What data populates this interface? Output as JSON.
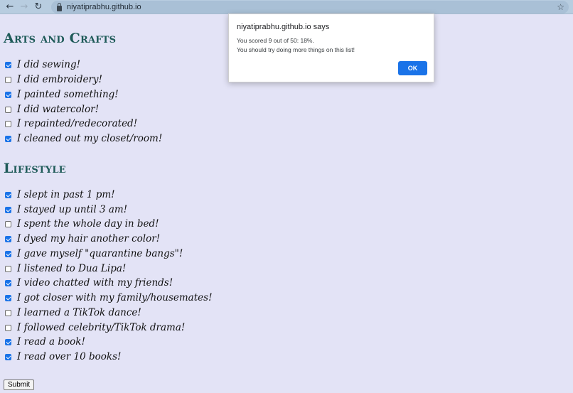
{
  "browser": {
    "back_icon": "←",
    "forward_icon": "→",
    "reload_icon": "↻",
    "url": "niyatiprabhu.github.io",
    "star_icon": "☆"
  },
  "sections": [
    {
      "title": "Arts and Crafts",
      "items": [
        {
          "label": "I did sewing!",
          "checked": true
        },
        {
          "label": "I did embroidery!",
          "checked": false
        },
        {
          "label": "I painted something!",
          "checked": true
        },
        {
          "label": "I did watercolor!",
          "checked": false
        },
        {
          "label": "I repainted/redecorated!",
          "checked": false
        },
        {
          "label": "I cleaned out my closet/room!",
          "checked": true
        }
      ]
    },
    {
      "title": "Lifestyle",
      "items": [
        {
          "label": "I slept in past 1 pm!",
          "checked": true
        },
        {
          "label": "I stayed up until 3 am!",
          "checked": true
        },
        {
          "label": "I spent the whole day in bed!",
          "checked": false
        },
        {
          "label": "I dyed my hair another color!",
          "checked": true
        },
        {
          "label": "I gave myself \"quarantine bangs\"!",
          "checked": true
        },
        {
          "label": "I listened to Dua Lipa!",
          "checked": false
        },
        {
          "label": "I video chatted with my friends!",
          "checked": true
        },
        {
          "label": "I got closer with my family/housemates!",
          "checked": true
        },
        {
          "label": "I learned a TikTok dance!",
          "checked": false
        },
        {
          "label": "I followed celebrity/TikTok drama!",
          "checked": false
        },
        {
          "label": "I read a book!",
          "checked": true
        },
        {
          "label": "I read over 10 books!",
          "checked": true
        }
      ]
    }
  ],
  "submit_label": "Submit",
  "dialog": {
    "origin": "niyatiprabhu.github.io says",
    "line1": "You scored 9 out of 50: 18%.",
    "line2": "You should try doing more things on this list!",
    "ok_label": "OK"
  }
}
